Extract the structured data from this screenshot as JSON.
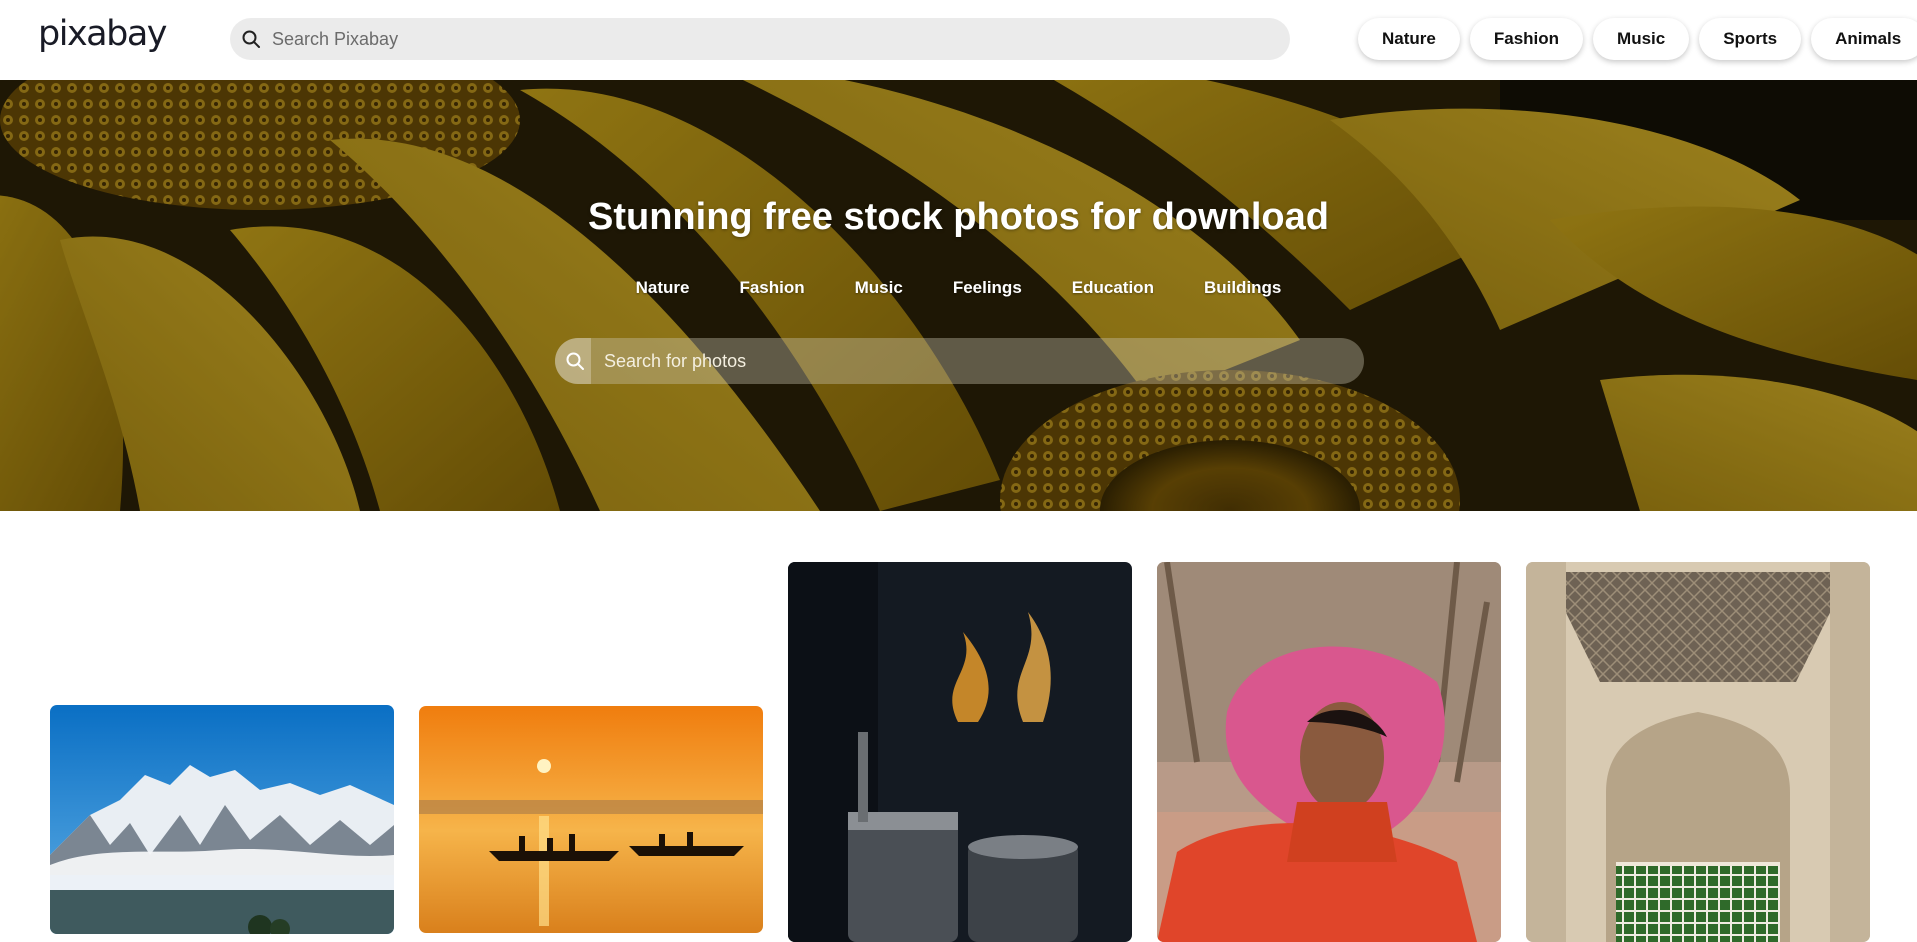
{
  "header": {
    "logo": "pixabay",
    "search_placeholder": "Search Pixabay",
    "chips": [
      "Nature",
      "Fashion",
      "Music",
      "Sports",
      "Animals"
    ]
  },
  "hero": {
    "title": "Stunning free stock photos for download",
    "categories": [
      "Nature",
      "Fashion",
      "Music",
      "Feelings",
      "Education",
      "Buildings"
    ],
    "search_placeholder": "Search for photos"
  },
  "photos": [
    {
      "subject": "snowy mountain range under blue sky"
    },
    {
      "subject": "boats on river at sunset"
    },
    {
      "subject": "steaming metal pots in dark kitchen"
    },
    {
      "subject": "woman in pink headscarf and orange dress"
    },
    {
      "subject": "ornate carved stone palace corridor"
    }
  ],
  "colors": {
    "logo": "#191b26",
    "search_bg": "#ebebeb",
    "hero_text": "#ffffff"
  }
}
